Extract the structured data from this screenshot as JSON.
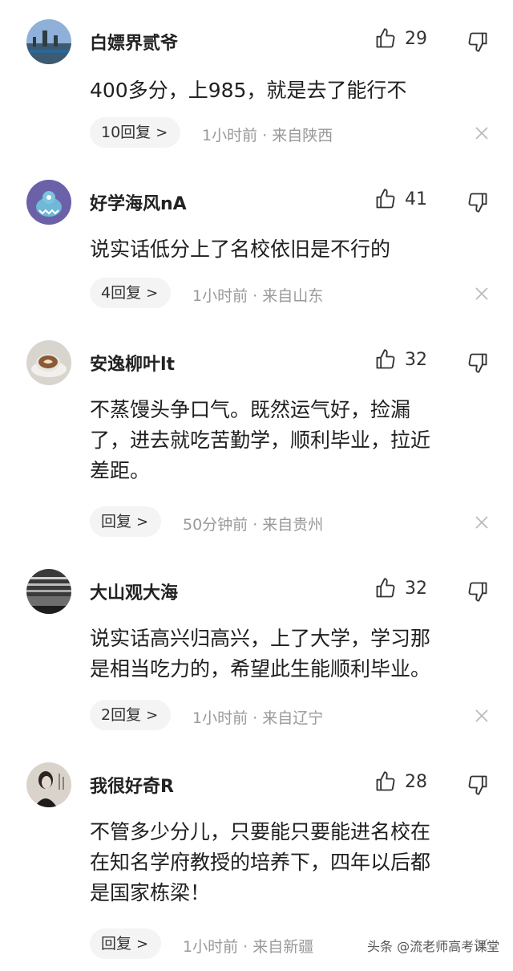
{
  "comments": [
    {
      "username": "白嫖界贰爷",
      "likes": "29",
      "text": "400多分，上985，就是去了能行不",
      "reply_label": "10回复",
      "meta": "1小时前 · 来自陕西"
    },
    {
      "username": "好学海风nA",
      "likes": "41",
      "text": "说实话低分上了名校依旧是不行的",
      "reply_label": "4回复",
      "meta": "1小时前 · 来自山东"
    },
    {
      "username": "安逸柳叶lt",
      "likes": "32",
      "text": "不蒸馒头争口气。既然运气好，捡漏\n了，进去就吃苦勤学，顺利毕业，拉近\n差距。",
      "reply_label": "回复",
      "meta": "50分钟前 · 来自贵州"
    },
    {
      "username": "大山观大海",
      "likes": "32",
      "text": "说实话高兴归高兴，上了大学，学习那\n是相当吃力的，希望此生能顺利毕业。",
      "reply_label": "2回复",
      "meta": "1小时前 · 来自辽宁"
    },
    {
      "username": "我很好奇R",
      "likes": "28",
      "text": "不管多少分儿，只要能只要能进名校在\n在知名学府教授的培养下，四年以后都\n是国家栋梁！",
      "reply_label": "回复",
      "meta": "1小时前 · 来自新疆"
    }
  ],
  "watermark": "头条 @流老师高考课堂",
  "icons": {
    "like": "thumbs-up-outline-icon",
    "dislike": "thumbs-down-outline-icon",
    "close": "close-icon"
  },
  "colors": {
    "text": "#222222",
    "meta": "#999999",
    "pill_bg": "#f4f4f4"
  }
}
